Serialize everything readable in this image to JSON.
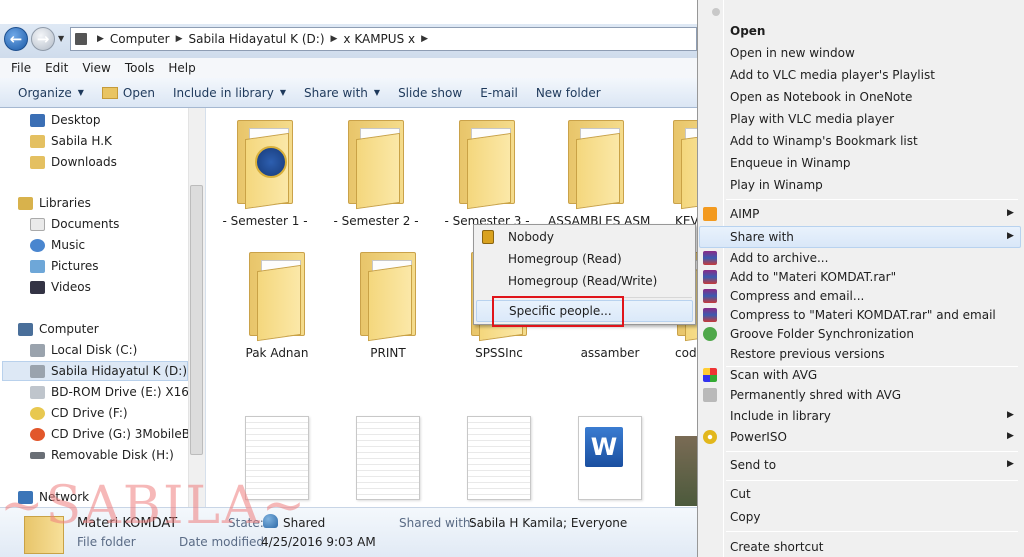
{
  "address": {
    "back_label": "←",
    "forward_label": "→",
    "crumbs": [
      "Computer",
      "Sabila Hidayatul K (D:)",
      "x KAMPUS x"
    ]
  },
  "menubar": [
    "File",
    "Edit",
    "View",
    "Tools",
    "Help"
  ],
  "toolbar": {
    "organize": "Organize",
    "open": "Open",
    "include_in_library": "Include in library",
    "share_with": "Share with",
    "slide_show": "Slide show",
    "email": "E-mail",
    "new_folder": "New folder"
  },
  "nav": {
    "desktop": "Desktop",
    "user": "Sabila H.K",
    "downloads": "Downloads",
    "libraries": "Libraries",
    "documents": "Documents",
    "music": "Music",
    "pictures": "Pictures",
    "videos": "Videos",
    "computer": "Computer",
    "local_disk": "Local Disk (C:)",
    "sabila_drive": "Sabila Hidayatul K (D:)",
    "bdrom": "BD-ROM Drive (E:) X16-81",
    "cd_f": "CD Drive (F:)",
    "cd_g": "CD Drive (G:) 3MobileBroa",
    "removable": "Removable Disk (H:)",
    "network": "Network"
  },
  "files": {
    "semester1": "- Semester 1 -",
    "semester2": "- Semester 2 -",
    "semester3": "- Semester 3 -",
    "assambles": "ASSAMBLES ASM",
    "kev": "KEV",
    "pak_adnan": "Pak Adnan",
    "print": "PRINT",
    "spssinc": "SPSSInc",
    "assamber": "assamber",
    "cod": "cod"
  },
  "share_submenu": {
    "nobody": "Nobody",
    "homegroup_read": "Homegroup (Read)",
    "homegroup_readwrite": "Homegroup (Read/Write)",
    "specific_people": "Specific people..."
  },
  "status": {
    "name": "Materi KOMDAT",
    "type": "File folder",
    "state_label": "State:",
    "state_value": "Shared",
    "shared_with_label": "Shared with:",
    "shared_with_value": "Sabila H Kamila; Everyone",
    "date_label": "Date modified:",
    "date_value": "4/25/2016 9:03 AM"
  },
  "watermark": "~SABILA~",
  "context_menu": {
    "open": "Open",
    "open_new_window": "Open in new window",
    "add_vlc": "Add to VLC media player's Playlist",
    "open_onenote": "Open as Notebook in OneNote",
    "play_vlc": "Play with VLC media player",
    "add_winamp_bookmark": "Add to Winamp's Bookmark list",
    "enqueue_winamp": "Enqueue in Winamp",
    "play_winamp": "Play in Winamp",
    "aimp": "AIMP",
    "share_with": "Share with",
    "add_archive": "Add to archive...",
    "add_rar": "Add to \"Materi KOMDAT.rar\"",
    "compress_email": "Compress and email...",
    "compress_rar_email": "Compress to \"Materi KOMDAT.rar\" and email",
    "groove": "Groove Folder Synchronization",
    "restore": "Restore previous versions",
    "scan_avg": "Scan with AVG",
    "shred_avg": "Permanently shred with AVG",
    "include_library": "Include in library",
    "poweriso": "PowerISO",
    "send_to": "Send to",
    "cut": "Cut",
    "copy": "Copy",
    "create_shortcut": "Create shortcut"
  },
  "colors": {
    "highlight_box": "#e0141a",
    "selection": "#dde8f5",
    "folder": "#f4d77d",
    "watermark": "#ee7e7e"
  }
}
